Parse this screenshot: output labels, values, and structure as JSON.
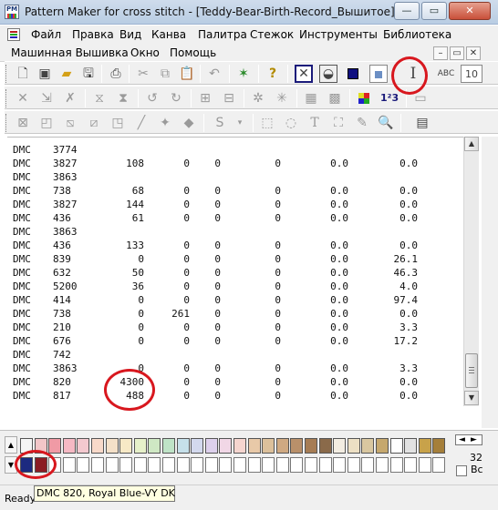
{
  "window": {
    "title": "Pattern Maker for cross stitch - [Teddy-Bear-Birth-Record_Вышитое]",
    "app_icon_text": "PM",
    "min_symbol": "—",
    "max_symbol": "▭",
    "close_symbol": "✕"
  },
  "menu": {
    "row1": [
      "Файл",
      "Правка",
      "Вид",
      "Канва",
      "Палитра",
      "Стежок",
      "Инструменты",
      "Библиотека"
    ],
    "row2": [
      "Машинная Вышивка",
      "Окно",
      "Помощь"
    ],
    "mdi_buttons": [
      "–",
      "▭",
      "✕"
    ]
  },
  "toolbars": {
    "tb1_icons": [
      "new-icon",
      "open-icon",
      "save-icon",
      "print-icon",
      "cut-icon",
      "copy-icon",
      "paste-icon",
      "undo-icon",
      "wizard-icon",
      "help-icon",
      "full-stitch-icon",
      "half-stitch-icon",
      "fill-color-icon",
      "text-tool-icon"
    ],
    "tb1_label_10": "10",
    "tb2_label_123": "1²3"
  },
  "report": {
    "rows": [
      {
        "brand": "DMC",
        "num": "3774",
        "v1": "",
        "v2": "",
        "v3": "",
        "v4": "",
        "v5": "",
        "v6": ""
      },
      {
        "brand": "DMC",
        "num": "3827",
        "v1": "108",
        "v2": "0",
        "v3": "0",
        "v4": "0",
        "v5": "0.0",
        "v6": "0.0"
      },
      {
        "brand": "DMC",
        "num": "3863",
        "v1": "",
        "v2": "",
        "v3": "",
        "v4": "",
        "v5": "",
        "v6": ""
      },
      {
        "brand": "DMC",
        "num": "738",
        "v1": "68",
        "v2": "0",
        "v3": "0",
        "v4": "0",
        "v5": "0.0",
        "v6": "0.0"
      },
      {
        "brand": "DMC",
        "num": "3827",
        "v1": "144",
        "v2": "0",
        "v3": "0",
        "v4": "0",
        "v5": "0.0",
        "v6": "0.0"
      },
      {
        "brand": "DMC",
        "num": "436",
        "v1": "61",
        "v2": "0",
        "v3": "0",
        "v4": "0",
        "v5": "0.0",
        "v6": "0.0"
      },
      {
        "brand": "DMC",
        "num": "3863",
        "v1": "",
        "v2": "",
        "v3": "",
        "v4": "",
        "v5": "",
        "v6": ""
      },
      {
        "brand": "DMC",
        "num": "436",
        "v1": "133",
        "v2": "0",
        "v3": "0",
        "v4": "0",
        "v5": "0.0",
        "v6": "0.0"
      },
      {
        "brand": "DMC",
        "num": "839",
        "v1": "0",
        "v2": "0",
        "v3": "0",
        "v4": "0",
        "v5": "0.0",
        "v6": "26.1"
      },
      {
        "brand": "DMC",
        "num": "632",
        "v1": "50",
        "v2": "0",
        "v3": "0",
        "v4": "0",
        "v5": "0.0",
        "v6": "46.3"
      },
      {
        "brand": "DMC",
        "num": "5200",
        "v1": "36",
        "v2": "0",
        "v3": "0",
        "v4": "0",
        "v5": "0.0",
        "v6": "4.0"
      },
      {
        "brand": "DMC",
        "num": "414",
        "v1": "0",
        "v2": "0",
        "v3": "0",
        "v4": "0",
        "v5": "0.0",
        "v6": "97.4"
      },
      {
        "brand": "DMC",
        "num": "738",
        "v1": "0",
        "v2": "261",
        "v3": "0",
        "v4": "0",
        "v5": "0.0",
        "v6": "0.0"
      },
      {
        "brand": "DMC",
        "num": "210",
        "v1": "0",
        "v2": "0",
        "v3": "0",
        "v4": "0",
        "v5": "0.0",
        "v6": "3.3"
      },
      {
        "brand": "DMC",
        "num": "676",
        "v1": "0",
        "v2": "0",
        "v3": "0",
        "v4": "0",
        "v5": "0.0",
        "v6": "17.2"
      },
      {
        "brand": "DMC",
        "num": "742",
        "v1": "",
        "v2": "",
        "v3": "",
        "v4": "",
        "v5": "",
        "v6": ""
      },
      {
        "brand": "DMC",
        "num": "3863",
        "v1": "0",
        "v2": "0",
        "v3": "0",
        "v4": "0",
        "v5": "0.0",
        "v6": "3.3"
      },
      {
        "brand": "DMC",
        "num": "820",
        "v1": "4300",
        "v2": "0",
        "v3": "0",
        "v4": "0",
        "v5": "0.0",
        "v6": "0.0"
      },
      {
        "brand": "DMC",
        "num": "817",
        "v1": "488",
        "v2": "0",
        "v3": "0",
        "v4": "0",
        "v5": "0.0",
        "v6": "0.0"
      }
    ]
  },
  "palette": {
    "row1_colors": [
      "#f5f5f5",
      "#f2c6c8",
      "#f09aa5",
      "#f6b9c4",
      "#f4c9cf",
      "#f8d9c9",
      "#f4e0c8",
      "#f7e9c6",
      "#e6f0c9",
      "#cfe8c4",
      "#bfe3c7",
      "#c6e0ea",
      "#d3d9ee",
      "#ddd0ec",
      "#f1d7e6",
      "#f5d5cf",
      "#e8c9a8",
      "#dcc09b",
      "#cfa982",
      "#b9906a",
      "#a67c54",
      "#8a6a4a",
      "#f3ede2",
      "#ede0c4",
      "#d9c7a0",
      "#c6a86e",
      "#ffffff",
      "#e2e2e2",
      "#c8a24a",
      "#a57f3a"
    ],
    "row2_selected": [
      "#1c2a80",
      "#8b1c23"
    ],
    "arrows": [
      "◄",
      "►"
    ],
    "count": "32",
    "checkbox_label": "Вс"
  },
  "status": {
    "text": "Ready",
    "tooltip": "DMC 820, Royal Blue-VY DK"
  },
  "colors": {
    "annotation_red": "#d8171e"
  }
}
